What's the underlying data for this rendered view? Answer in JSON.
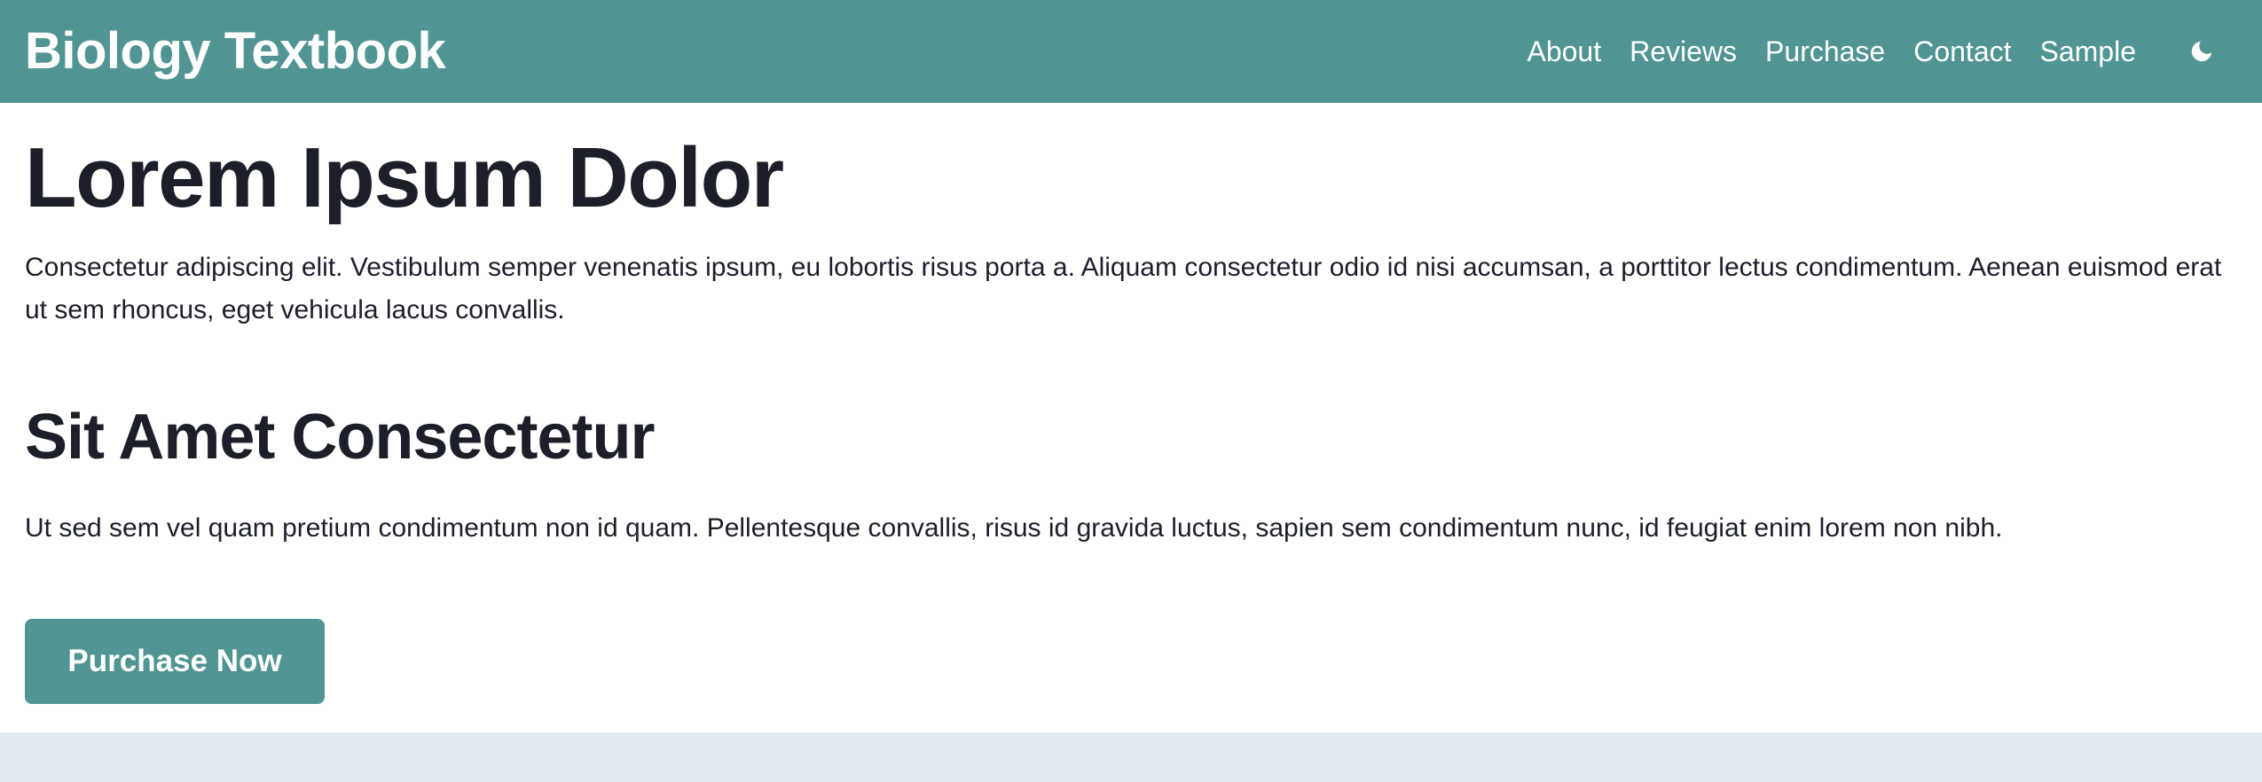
{
  "brand": {
    "title": "Biology Textbook",
    "color": "#509593"
  },
  "nav": {
    "items": [
      {
        "label": "About"
      },
      {
        "label": "Reviews"
      },
      {
        "label": "Purchase"
      },
      {
        "label": "Contact"
      },
      {
        "label": "Sample"
      }
    ],
    "theme_toggle_icon": "moon-icon"
  },
  "main": {
    "heading": "Lorem Ipsum Dolor",
    "intro": "Consectetur adipiscing elit. Vestibulum semper venenatis ipsum, eu lobortis risus porta a. Aliquam consectetur odio id nisi accumsan, a porttitor lectus condimentum. Aenean euismod erat ut sem rhoncus, eget vehicula lacus convallis.",
    "subheading": "Sit Amet Consectetur",
    "body": "Ut sed sem vel quam pretium condimentum non id quam. Pellentesque convallis, risus id gravida luctus, sapien sem condimentum nunc, id feugiat enim lorem non nibh.",
    "cta_label": "Purchase Now"
  },
  "colors": {
    "accent": "#509593",
    "text": "#1c1f2a",
    "page_background": "#e2e8f0"
  }
}
